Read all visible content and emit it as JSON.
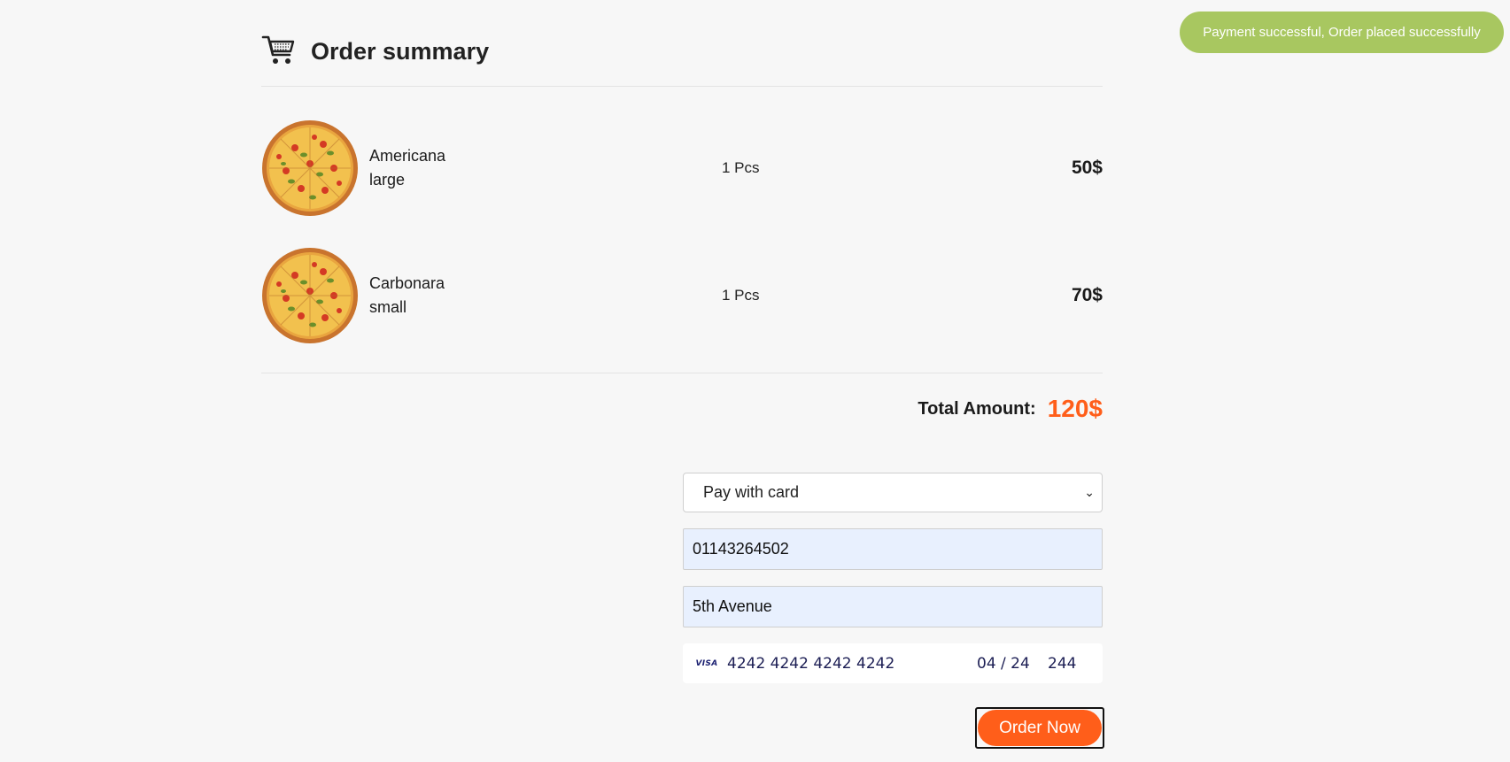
{
  "toast": {
    "message": "Payment successful, Order placed successfully"
  },
  "header": {
    "title": "Order summary",
    "icon": "cart-icon"
  },
  "items": [
    {
      "name": "Americana",
      "size": "large",
      "qty": "1 Pcs",
      "price": "50$"
    },
    {
      "name": "Carbonara",
      "size": "small",
      "qty": "1 Pcs",
      "price": "70$"
    }
  ],
  "total": {
    "label": "Total Amount:",
    "value": "120$"
  },
  "payment": {
    "method": "Pay with card",
    "phone": "01143264502",
    "address": "5th Avenue",
    "card": {
      "brand": "VISA",
      "number": "4242 4242 4242 4242",
      "expiry": "04 / 24",
      "cvc": "244"
    }
  },
  "actions": {
    "order_label": "Order Now"
  },
  "colors": {
    "accent": "#ff5e1a",
    "toast": "#a8c760",
    "autofill": "#e8f0fe"
  }
}
